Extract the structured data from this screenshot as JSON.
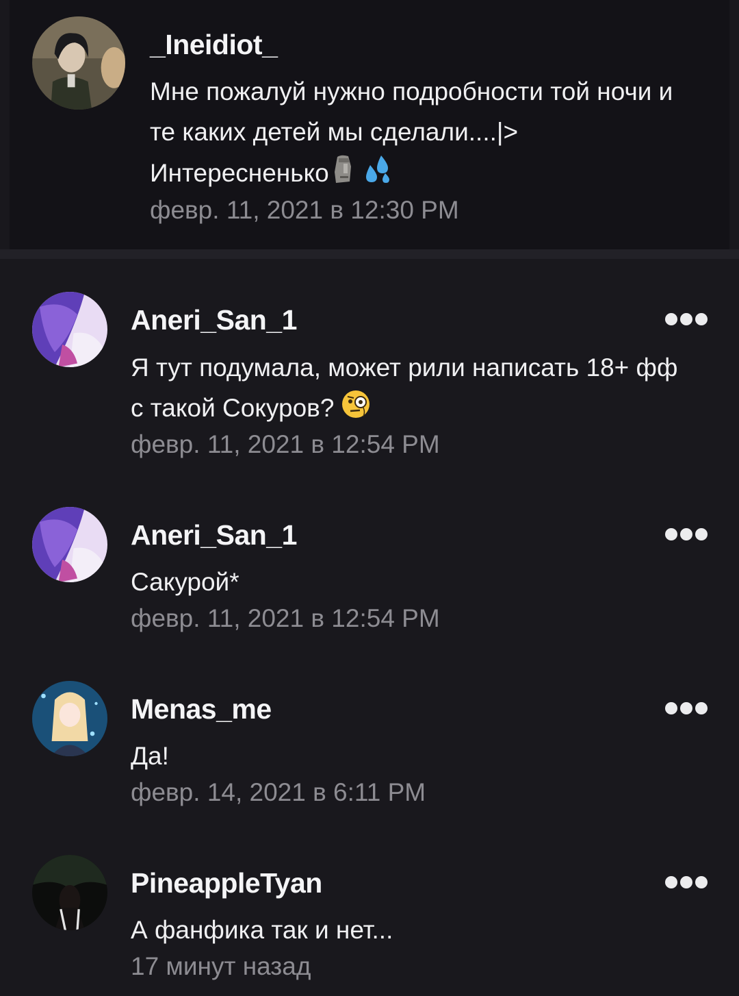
{
  "comments": [
    {
      "username": "_Ineidiot_",
      "lines": [
        "Мне пожалуй нужно подробности той ночи и",
        "те каких детей мы сделали....|>",
        "Интересненько"
      ],
      "emojis": [
        "moai-icon",
        "sweat-droplets-icon"
      ],
      "time": "февр. 11, 2021 в 12:30 PM",
      "pinned": true
    },
    {
      "username": "Aneri_San_1",
      "lines": [
        "Я тут подумала, может рили написать 18+ фф",
        "с такой Сокуров?"
      ],
      "emojis": [
        "face-with-monocle-icon"
      ],
      "time": "февр. 11, 2021 в 12:54 PM"
    },
    {
      "username": "Aneri_San_1",
      "lines": [
        "Сакурой*"
      ],
      "time": "февр. 11, 2021 в 12:54 PM"
    },
    {
      "username": "Menas_me",
      "lines": [
        "Да!"
      ],
      "time": "февр. 14, 2021 в 6:11 PM"
    },
    {
      "username": "PineappleTyan",
      "lines": [
        "А фанфика так и нет..."
      ],
      "time": "17 минут назад"
    }
  ],
  "colors": {
    "background": "#19181d",
    "pinned_background": "#131217",
    "timestamp": "#8d8c92",
    "text": "#f0f0f2"
  }
}
